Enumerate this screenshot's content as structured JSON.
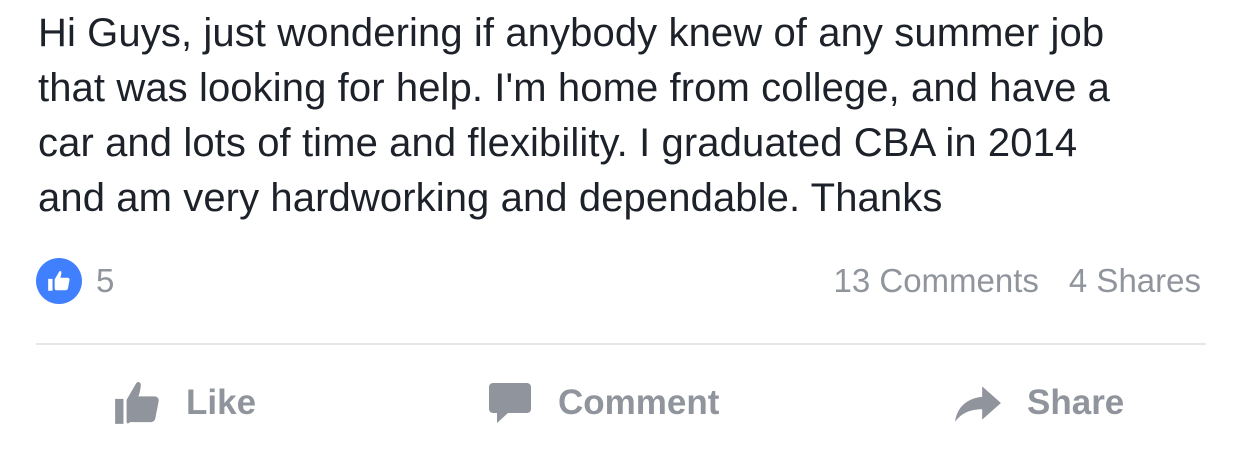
{
  "post": {
    "text_lines": [
      "Hi Guys, just wondering if anybody knew of any summer job",
      "that was looking for help. I'm home from college, and have a",
      "car and lots of time and flexibility. I graduated CBA in 2014",
      "and am very hardworking and dependable. Thanks"
    ]
  },
  "stats": {
    "like_count": "5",
    "comments": "13 Comments",
    "shares": "4 Shares"
  },
  "actions": {
    "like_label": "Like",
    "comment_label": "Comment",
    "share_label": "Share",
    "like_icon": "thumbs-up-icon",
    "comment_icon": "speech-bubble-icon",
    "share_icon": "share-arrow-icon"
  },
  "colors": {
    "text": "#1d2129",
    "muted": "#90949c",
    "like_blue": "#4080ff",
    "divider": "#e5e6e9"
  }
}
